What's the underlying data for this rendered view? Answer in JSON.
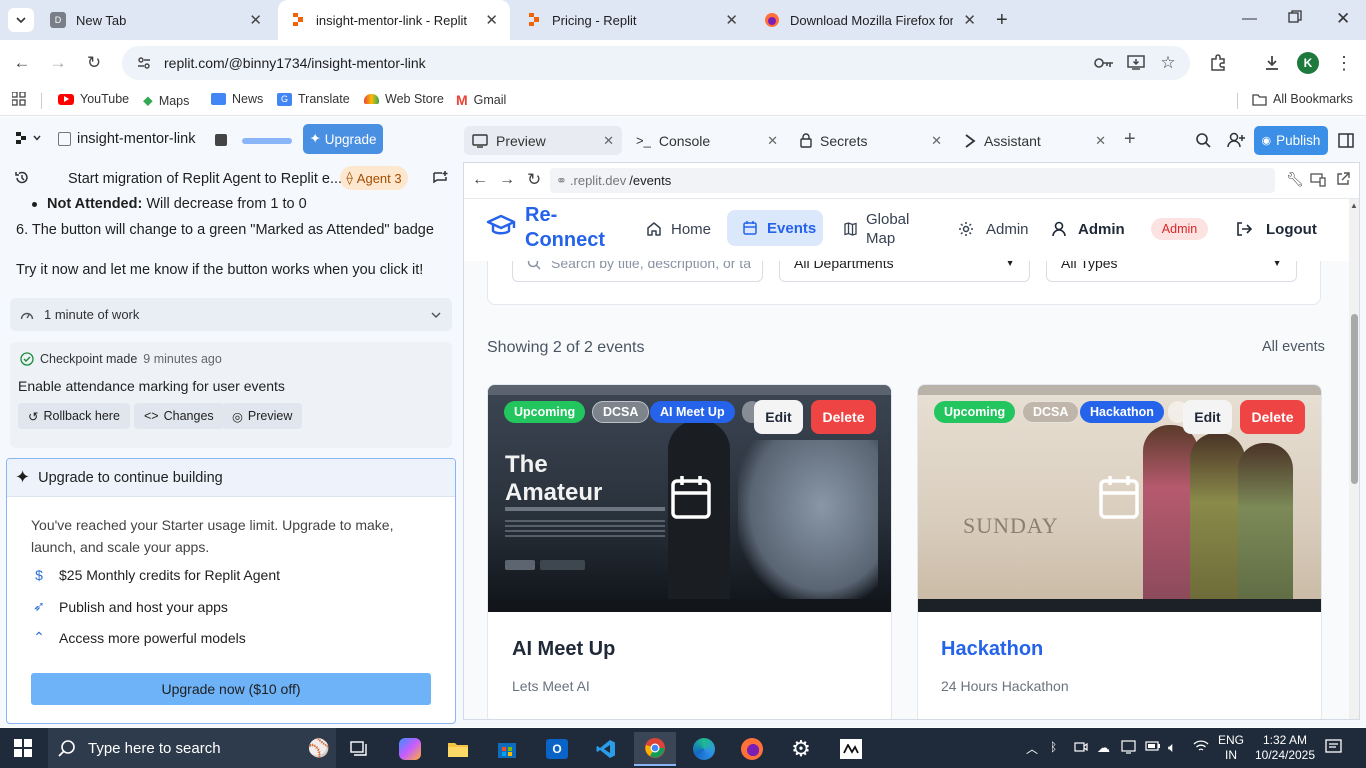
{
  "browser": {
    "tabs": [
      {
        "title": "New Tab",
        "favicon": "D",
        "active": false
      },
      {
        "title": "insight-mentor-link - Replit",
        "favicon": "replit",
        "active": true
      },
      {
        "title": "Pricing - Replit",
        "favicon": "replit",
        "active": false
      },
      {
        "title": "Download Mozilla Firefox for W",
        "favicon": "firefox",
        "active": false
      }
    ],
    "url": "replit.com/@binny1734/insight-mentor-link",
    "profile_initial": "K",
    "bookmarks": [
      "YouTube",
      "Maps",
      "News",
      "Translate",
      "Web Store",
      "Gmail"
    ],
    "all_bookmarks": "All Bookmarks"
  },
  "replit": {
    "project_name": "insight-mentor-link",
    "upgrade_label": "Upgrade",
    "thread_title": "Start migration of Replit Agent to Replit e...",
    "agent_badge": "Agent 3",
    "message": {
      "bullet_bold": "Not Attended:",
      "bullet_rest": " Will decrease from 1 to 0",
      "step6": "6. The button will change to a green \"Marked as Attended\" badge",
      "try_it": "Try it now and let me know if the button works when you click it!"
    },
    "work_summary": "1 minute of work",
    "checkpoint": {
      "label": "Checkpoint made",
      "time": "9 minutes ago",
      "description": "Enable attendance marking for user events",
      "rollback": "Rollback here",
      "changes": "Changes",
      "preview": "Preview"
    },
    "upgrade_card": {
      "title": "Upgrade to continue building",
      "body": "You've reached your Starter usage limit. Upgrade to make, launch, and scale your apps.",
      "features": [
        {
          "icon": "dollar-icon",
          "text": "$25 Monthly credits for Replit Agent"
        },
        {
          "icon": "rocket-icon",
          "text": "Publish and host your apps"
        },
        {
          "icon": "chevrons-up-icon",
          "text": "Access more powerful models"
        }
      ],
      "cta": "Upgrade now ($10 off)"
    },
    "panel_tabs": [
      {
        "label": "Preview",
        "icon": "preview-icon"
      },
      {
        "label": "Console",
        "icon": "console-icon"
      },
      {
        "label": "Secrets",
        "icon": "lock-icon"
      },
      {
        "label": "Assistant",
        "icon": "assistant-icon"
      }
    ],
    "publish_label": "Publish",
    "preview_url_domain": ".replit.dev",
    "preview_url_path": "/events"
  },
  "site": {
    "brand_line1": "Re-",
    "brand_line2": "Connect",
    "nav": [
      {
        "label": "Home",
        "icon": "home-icon"
      },
      {
        "label": "Events",
        "icon": "calendar-icon"
      },
      {
        "label": "Global\nMap",
        "icon": "map-icon"
      },
      {
        "label": "Admin",
        "icon": "gear-icon"
      }
    ],
    "user_name": "Admin",
    "user_role": "Admin",
    "logout": "Logout",
    "search_placeholder": "Search by title, description, or ta",
    "department_filter": "All Departments",
    "type_filter": "All Types",
    "showing": "Showing 2 of 2 events",
    "all_events": "All events",
    "events": [
      {
        "status": "Upcoming",
        "dept": "DCSA",
        "type": "AI Meet Up",
        "title": "AI Meet Up",
        "desc": "Lets Meet AI",
        "image_text": [
          "The",
          "Amateur"
        ],
        "title_color": "#1f2937"
      },
      {
        "status": "Upcoming",
        "dept": "DCSA",
        "type": "Hackathon",
        "title": "Hackathon",
        "desc": "24 Hours Hackathon",
        "image_text": [
          "SUNDAY"
        ],
        "title_color": "#2563eb"
      }
    ],
    "edit_label": "Edit",
    "delete_label": "Delete"
  },
  "taskbar": {
    "search_placeholder": "Type here to search",
    "lang_line1": "ENG",
    "lang_line2": "IN",
    "time": "1:32 AM",
    "date": "10/24/2025"
  }
}
